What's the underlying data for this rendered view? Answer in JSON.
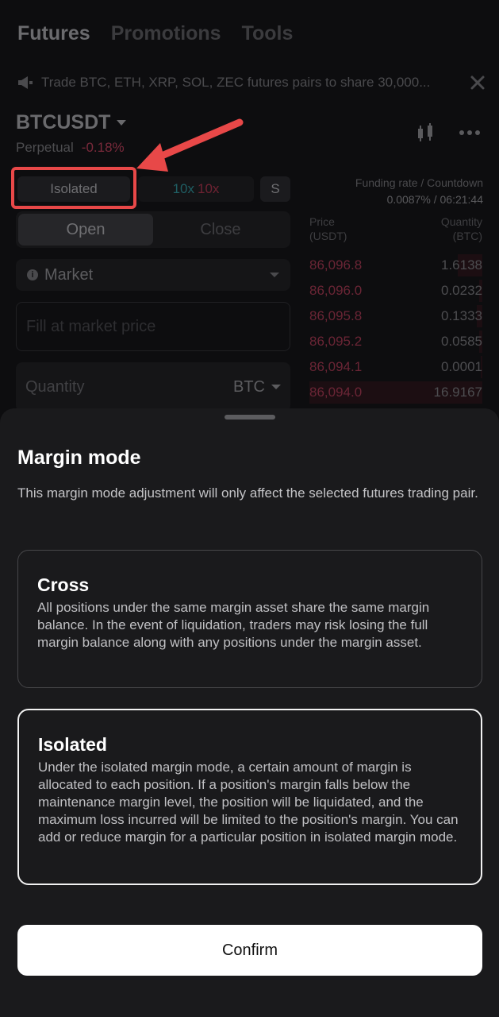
{
  "nav": {
    "tabs": [
      "Futures",
      "Promotions",
      "Tools"
    ]
  },
  "banner": {
    "text": "Trade BTC, ETH, XRP, SOL, ZEC futures pairs to share 30,000..."
  },
  "pair": {
    "symbol": "BTCUSDT",
    "type": "Perpetual",
    "change": "-0.18%"
  },
  "controls": {
    "margin_mode": "Isolated",
    "leverage_long": "10x",
    "leverage_short": "10x",
    "s_label": "S"
  },
  "funding": {
    "label": "Funding rate / Countdown",
    "value": "0.0087% / 06:21:44"
  },
  "order_tabs": {
    "open": "Open",
    "close": "Close"
  },
  "order_type": {
    "label": "Market"
  },
  "price_field": {
    "placeholder": "Fill at market price"
  },
  "quantity_field": {
    "label": "Quantity",
    "unit": "BTC"
  },
  "orderbook": {
    "price_header": "Price",
    "price_unit": "(USDT)",
    "qty_header": "Quantity",
    "qty_unit": "(BTC)",
    "rows": [
      {
        "price": "86,096.8",
        "qty": "1.6138",
        "depth": 0.14
      },
      {
        "price": "86,096.0",
        "qty": "0.0232",
        "depth": 0.02
      },
      {
        "price": "86,095.8",
        "qty": "0.1333",
        "depth": 0.03
      },
      {
        "price": "86,095.2",
        "qty": "0.0585",
        "depth": 0.02
      },
      {
        "price": "86,094.1",
        "qty": "0.0001",
        "depth": 0.01
      },
      {
        "price": "86,094.0",
        "qty": "16.9167",
        "depth": 1.0
      }
    ]
  },
  "sheet": {
    "title": "Margin mode",
    "description": "This margin mode adjustment will only affect the selected futures trading pair.",
    "options": [
      {
        "title": "Cross",
        "description": "All positions under the same margin asset share the same margin balance. In the event of liquidation, traders may risk losing the full margin balance along with any positions under the margin asset.",
        "selected": false
      },
      {
        "title": "Isolated",
        "description": "Under the isolated margin mode, a certain amount of margin is allocated to each position. If a position's margin falls below the maintenance margin level, the position will be liquidated, and the maximum loss incurred will be limited to the position's margin. You can add or reduce margin for a particular position in isolated margin mode.",
        "selected": true
      }
    ],
    "confirm_label": "Confirm"
  },
  "colors": {
    "annotation": "#e84848",
    "sell_price": "#6a2535",
    "sheet_bg": "#1a1a1c",
    "confirm_bg": "#ffffff"
  }
}
